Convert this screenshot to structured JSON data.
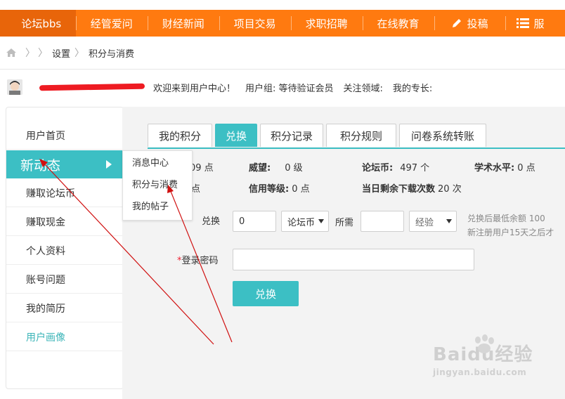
{
  "nav": {
    "brand": "论坛bbs",
    "items": [
      "经管爱问",
      "财经新闻",
      "项目交易",
      "求职招聘",
      "在线教育"
    ],
    "post_label": "投稿",
    "more_label": "服"
  },
  "breadcrumb": {
    "items": [
      "设置",
      "积分与消费"
    ]
  },
  "user": {
    "welcome": "欢迎来到用户中心！",
    "group": "用户组: 等待验证会员",
    "field": "关注领域:",
    "skill": "我的专长:"
  },
  "sidebar": {
    "items": [
      {
        "label": "用户首页"
      },
      {
        "label": "新动态"
      },
      {
        "label": "赚取论坛币"
      },
      {
        "label": "赚取现金"
      },
      {
        "label": "个人资料"
      },
      {
        "label": "账号问题"
      },
      {
        "label": "我的简历"
      },
      {
        "label": "用户画像"
      }
    ]
  },
  "popup": {
    "items": [
      "消息中心",
      "积分与消费",
      "我的帖子"
    ]
  },
  "tabs": [
    "我的积分",
    "兑换",
    "积分记录",
    "积分规则",
    "问卷系统转账"
  ],
  "stats": {
    "row1": [
      {
        "value": "09 点"
      },
      {
        "label": "威望:",
        "value": "0 级"
      },
      {
        "label": "论坛币:",
        "value": "497 个"
      },
      {
        "label": "学术水平:",
        "value": "0 点"
      }
    ],
    "row2": [
      {
        "value": "点"
      },
      {
        "label": "信用等级:",
        "value": "0 点"
      },
      {
        "label": "当日剩余下载次数",
        "value": "20 次"
      }
    ]
  },
  "form": {
    "exchange_label": "兑换",
    "amount_value": "0",
    "currency_from": "论坛币",
    "need_label": "所需",
    "need_value": "",
    "currency_to": "经验",
    "hint1": "兑换后最低余额 100",
    "hint2": "新注册用户15天之后才",
    "password_label": "登录密码",
    "required_mark": "*",
    "submit_label": "兑换"
  },
  "watermark": {
    "main": "Baidu经验",
    "sub": "jingyan.baidu.com"
  },
  "colors": {
    "nav": "#ff7a10",
    "accent": "#3cbfc4",
    "annotation": "#d01010"
  }
}
